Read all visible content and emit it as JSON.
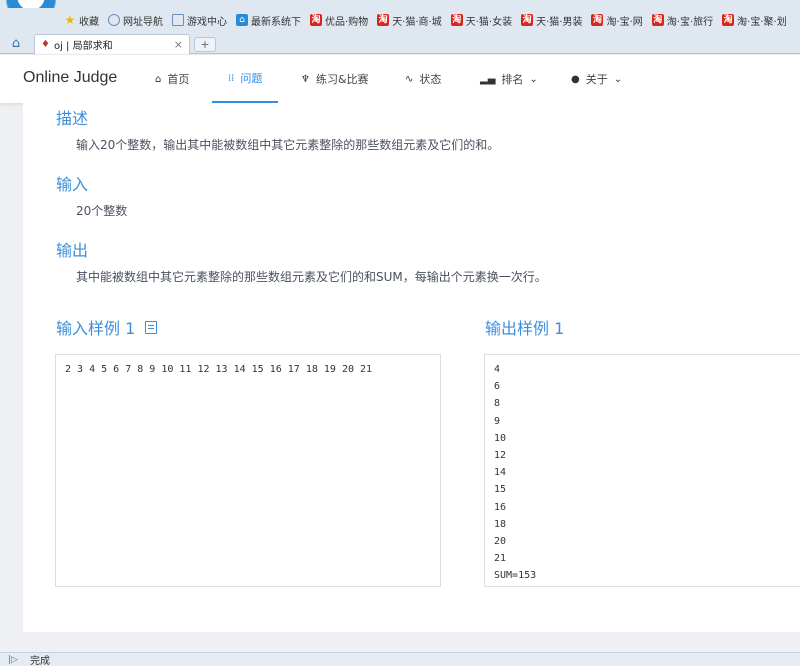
{
  "bookmarks": [
    {
      "label": "收藏",
      "icon": "star-icon"
    },
    {
      "label": "网址导航",
      "icon": "globe-icon"
    },
    {
      "label": "游戏中心",
      "icon": "page-icon"
    },
    {
      "label": "最新系统下",
      "icon": "blue-site-icon"
    },
    {
      "label": "优品·购物",
      "icon": "taobao-icon"
    },
    {
      "label": "天·猫·商·城",
      "icon": "taobao-icon"
    },
    {
      "label": "天·猫·女装",
      "icon": "taobao-icon"
    },
    {
      "label": "天·猫·男装",
      "icon": "taobao-icon"
    },
    {
      "label": "淘·宝·网",
      "icon": "taobao-icon"
    },
    {
      "label": "淘·宝·旅行",
      "icon": "taobao-icon"
    },
    {
      "label": "淘·宝·聚·划",
      "icon": "taobao-icon"
    }
  ],
  "tab": {
    "title": "oj | 局部求和",
    "close": "×",
    "new": "+"
  },
  "site": {
    "brand": "Online Judge",
    "nav": [
      {
        "label": "首页",
        "icon": "home-icon"
      },
      {
        "label": "问题",
        "icon": "grid-icon",
        "active": true
      },
      {
        "label": "练习&比赛",
        "icon": "trophy-icon"
      },
      {
        "label": "状态",
        "icon": "pulse-icon"
      },
      {
        "label": "排名",
        "icon": "bar-chart-icon",
        "dropdown": true
      },
      {
        "label": "关于",
        "icon": "info-icon",
        "dropdown": true
      }
    ]
  },
  "problem": {
    "description_title": "描述",
    "description": "输入20个整数，输出其中能被数组中其它元素整除的那些数组元素及它们的和。",
    "input_title": "输入",
    "input": "20个整数",
    "output_title": "输出",
    "output": "其中能被数组中其它元素整除的那些数组元素及它们的和SUM，每输出个元素换一次行。",
    "sample_input_title": "输入样例 1",
    "sample_output_title": "输出样例 1",
    "sample_input": "2 3 4 5 6 7 8 9 10 11 12 13 14 15 16 17 18 19 20 21",
    "sample_output": "4\n6\n8\n9\n10\n12\n14\n15\n16\n18\n20\n21\nSUM=153"
  },
  "statusbar": {
    "text": "完成"
  },
  "colors": {
    "accent": "#2d8cf0",
    "section_title": "#3d8fd9"
  }
}
